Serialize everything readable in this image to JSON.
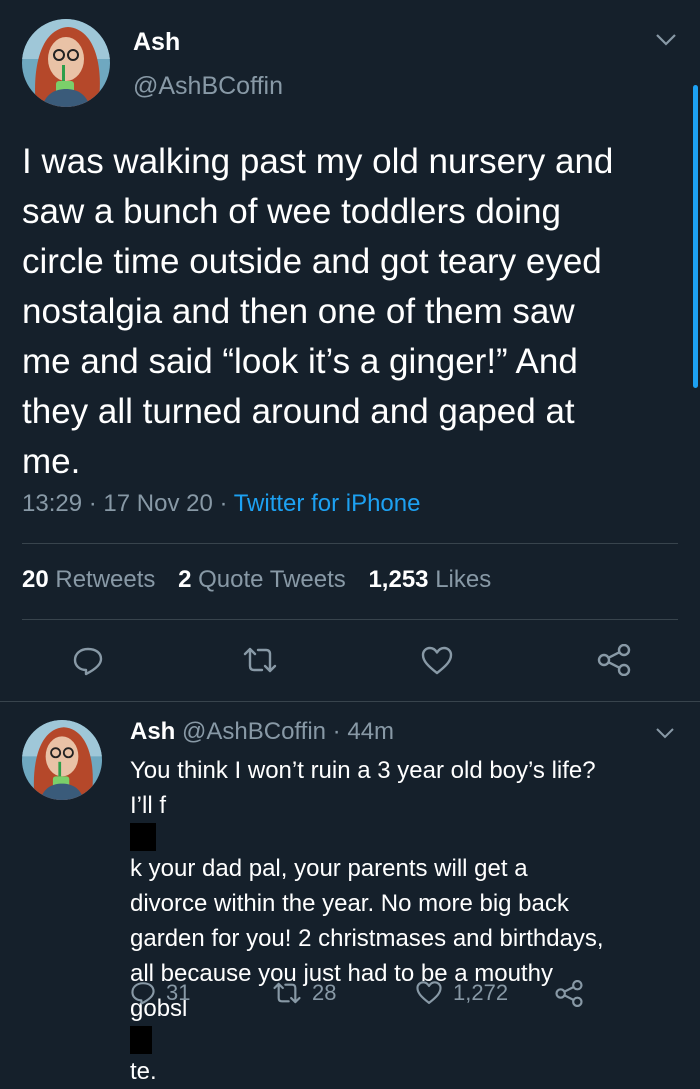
{
  "main_tweet": {
    "author_name": "Ash",
    "author_handle": "@AshBCoffin",
    "text_lines": [
      "I was walking past my old nursery and",
      "saw a bunch of wee toddlers doing",
      "circle time outside and got teary eyed",
      "nostalgia and then one of them saw",
      "me and said “look it’s a ginger!” And",
      "they all turned around and gaped at",
      "me."
    ],
    "time": "13:29",
    "date": "17 Nov 20",
    "source": "Twitter for iPhone",
    "stats": {
      "retweets_count": "20",
      "retweets_label": "Retweets",
      "quotes_count": "2",
      "quotes_label": "Quote Tweets",
      "likes_count": "1,253",
      "likes_label": "Likes"
    }
  },
  "reply": {
    "author_name": "Ash",
    "author_handle": "@AshBCoffin",
    "age": "44m",
    "line1": "You think I won’t ruin a 3 year old boy’s life?",
    "line2_a": "I’ll f",
    "line2_b": "k your dad pal, your parents will get a",
    "line3": "divorce within the year. No more big back",
    "line4": "garden for you! 2 christmases and birthdays,",
    "line5": "all because you just had to be a mouthy",
    "line6_a": "gobsl",
    "line6_b": "te.",
    "replies": "31",
    "retweets": "28",
    "likes": "1,272"
  },
  "colors": {
    "background": "#15202b",
    "secondary_text": "#8899a6",
    "accent": "#1da1f2",
    "divider": "#38444d"
  },
  "icons": [
    "reply-icon",
    "retweet-icon",
    "like-icon",
    "share-icon",
    "chevron-down-icon"
  ]
}
